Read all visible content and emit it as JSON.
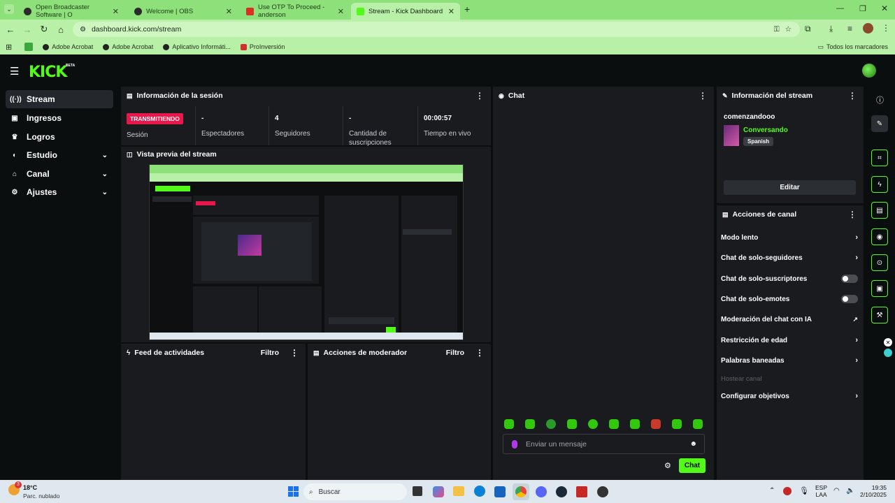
{
  "browser": {
    "tabs": [
      {
        "title": "Open Broadcaster Software | O"
      },
      {
        "title": "Welcome | OBS"
      },
      {
        "title": "Use OTP To Proceed - anderson"
      },
      {
        "title": "Stream - Kick Dashboard"
      }
    ],
    "url": "dashboard.kick.com/stream",
    "bookmarks": [
      "Adobe Acrobat",
      "Adobe Acrobat",
      "Aplicativo Informáti...",
      "ProInversión"
    ],
    "all_bookmarks": "Todos los marcadores"
  },
  "app": {
    "logo": "KICK",
    "beta": "BETA"
  },
  "sidebar": {
    "items": [
      {
        "label": "Stream",
        "icon": "broadcast-icon"
      },
      {
        "label": "Ingresos",
        "icon": "wallet-icon"
      },
      {
        "label": "Logros",
        "icon": "trophy-icon"
      },
      {
        "label": "Estudio",
        "icon": "studio-icon"
      },
      {
        "label": "Canal",
        "icon": "channel-icon"
      },
      {
        "label": "Ajustes",
        "icon": "gear-icon"
      }
    ]
  },
  "session": {
    "title": "Información de la sesión",
    "live_badge": "TRANSMITIENDO",
    "session_label": "Sesión",
    "viewers_value": "-",
    "viewers_label": "Espectadores",
    "followers_value": "4",
    "followers_label": "Seguidores",
    "subs_value": "-",
    "subs_label": "Cantidad de suscripciones",
    "time_value": "00:00:57",
    "time_label": "Tiempo en vivo"
  },
  "preview": {
    "title": "Vista previa del stream"
  },
  "feed": {
    "title": "Feed de actividades",
    "filter": "Filtro"
  },
  "mod": {
    "title": "Acciones de moderador",
    "filter": "Filtro"
  },
  "chat": {
    "title": "Chat",
    "placeholder": "Enviar un mensaje",
    "send": "Chat"
  },
  "stream_info": {
    "title": "Información del stream",
    "stream_title": "comenzandooo",
    "category": "Conversando",
    "language": "Spanish",
    "edit": "Editar"
  },
  "channel_actions": {
    "title": "Acciones de canal",
    "items": [
      {
        "label": "Modo lento",
        "kind": "chevron"
      },
      {
        "label": "Chat de solo-seguidores",
        "kind": "chevron"
      },
      {
        "label": "Chat de solo-suscriptores",
        "kind": "toggle"
      },
      {
        "label": "Chat de solo-emotes",
        "kind": "toggle"
      },
      {
        "label": "Moderación del chat con IA",
        "kind": "external"
      },
      {
        "label": "Restricción de edad",
        "kind": "chevron"
      },
      {
        "label": "Palabras baneadas",
        "kind": "chevron"
      },
      {
        "label": "Hostear canal",
        "kind": "disabled"
      },
      {
        "label": "Configurar objetivos",
        "kind": "chevron"
      }
    ]
  },
  "taskbar": {
    "weather_temp": "18°C",
    "weather_desc": "Parc. nublado",
    "notif_count": "3",
    "search": "Buscar",
    "lang": "ESP",
    "lang2": "LAA",
    "time": "19:35",
    "date": "2/10/2025"
  },
  "colors": {
    "accent": "#53fc18",
    "live": "#e8174c",
    "panel": "#191b1f",
    "bg": "#0b0e0f"
  }
}
